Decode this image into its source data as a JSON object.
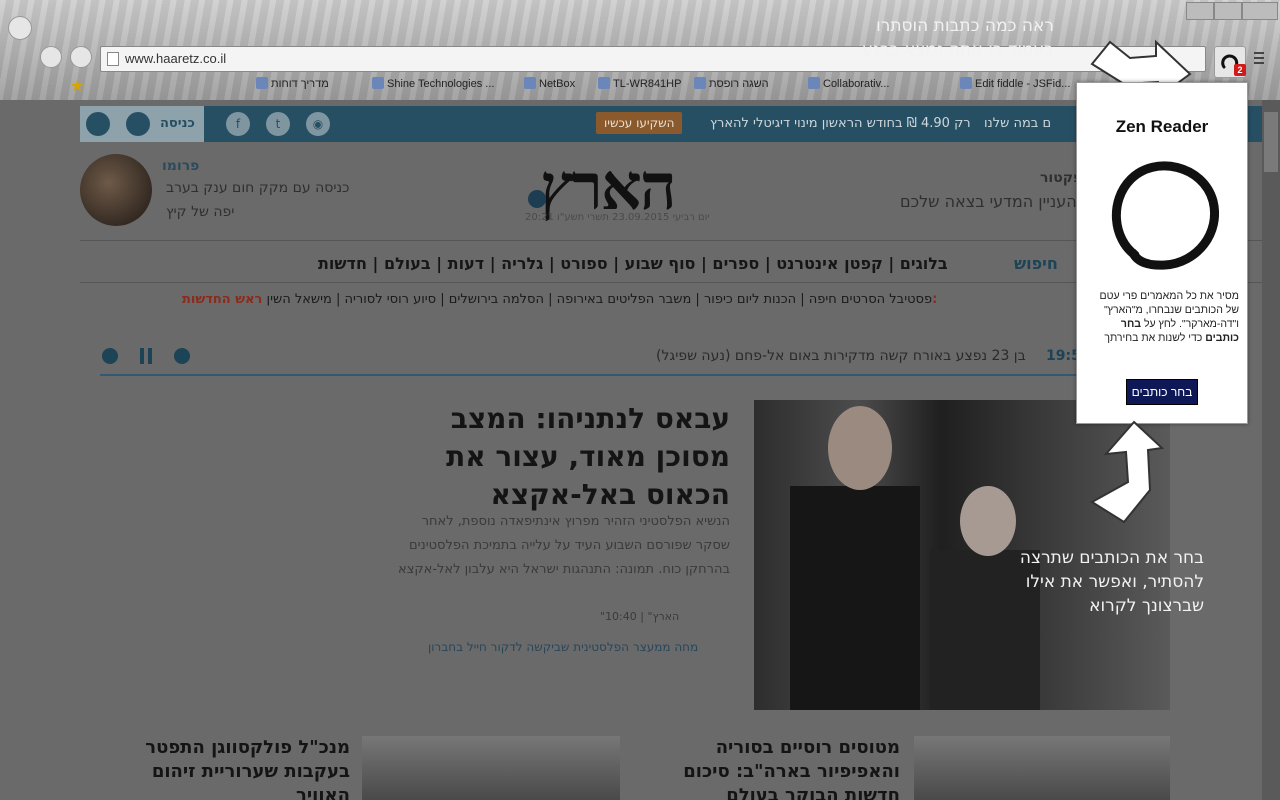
{
  "browser": {
    "url": "www.haaretz.co.il",
    "bookmarks": [
      "מדריך דוחות",
      "Shine Technologies ...",
      "NetBox",
      "TL-WR841HP",
      "השגה רופסת",
      "Collaborativ...",
      "Edit fiddle - JSFid..."
    ],
    "extension_badge": "2"
  },
  "site": {
    "promo_bar_text": "רק 4.90 ₪ בחודש הראשון מינוי דיגיטלי להארץ",
    "promo_bar_prefix": "ם במה שלנו",
    "subscribe_button": "השקיעו עכשיו",
    "login_label": "כניסה",
    "logo": "הארץ",
    "date_line": "יום רביעי 23.09.2015 תשרי תשע\"ו 20:21",
    "promo_right_title": "פרומו",
    "promo_right_line1": "כניסה עם מקק חום ענק בערב",
    "promo_right_line2": "יפה של קיץ",
    "promo_left_title": "ו פקטור",
    "promo_left_line1": "העניין המדעי בצאה שלכם",
    "search_label": "חיפוש",
    "nav_items": [
      "חדשות",
      "בעולם",
      "דעות",
      "גלריה",
      "ספורט",
      "סוף שבוע",
      "ספרים",
      "קפטן אינטרנט",
      "בלוגים"
    ],
    "subnav_label": "ראש החדשות:",
    "subnav_items": [
      "מישאל השין",
      "סיוע רוסי לסוריה",
      "הסלמה בירושלים",
      "משבר הפליטים באירופה",
      "הכנות ליום כיפור",
      "פסטיבל הסרטים חיפה"
    ],
    "ticker_time": "19:5",
    "ticker_text": "בן 23 נפצע באורח קשה מדקירות באום אל-פחם (נעה שפיגל)",
    "headline": "עבאס לנתניהו: המצב מסוכן מאוד, עצור את הכאוס באל-אקצא",
    "dek": "הנשיא הפלסטיני הזהיר מפרוץ אינתיפאדה נוספת, לאחר שסקר שפורסם השבוע העיד על עלייה בתמיכת הפלסטינים בהרחקן כוח. תמונה: התנהגות ישראל היא עלבון לאל-אקצא",
    "byline": "\"הארץ\" | 10:40",
    "related": "מחה ממעצר הפלסטינית שביקשה לדקור חייל בחברון",
    "card1_headline": "מטוסים רוסיים בסוריה והאפיפיור בארה\"ב: סיכום חדשות הבוקר בעולם",
    "card2_headline": "מנכ\"ל פולקסווגן התפטר בעקבות שערוריית זיהום האוויר"
  },
  "overlay": {
    "top_note": "ראה כמה כתבות הוסתרו בעמוד בו אתה נמצא כרגע",
    "bottom_note": "בחר את הכותבים שתרצה להסתיר, ואפשר את אילו שברצונך לקרוא",
    "popup_title": "Zen Reader",
    "popup_desc_1": "מסיר את כל המאמרים פרי עטם של הכותבים שנבחרו, מ\"הארץ\" ו\"דה-מארקר\". לחץ על",
    "popup_desc_bold": "בחר כותבים",
    "popup_desc_2": "כדי לשנות את בחירתך",
    "popup_button": "בחר כותבים"
  }
}
